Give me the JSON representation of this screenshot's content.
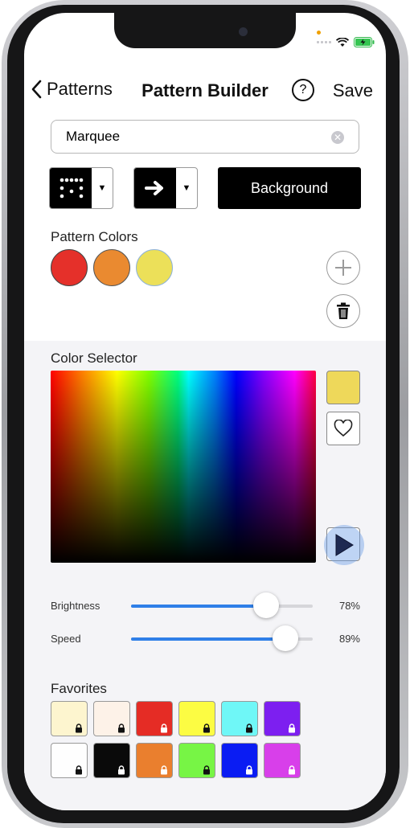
{
  "nav": {
    "back_label": "Patterns",
    "title": "Pattern Builder",
    "help_label": "?",
    "save_label": "Save"
  },
  "name_field": {
    "value": "Marquee"
  },
  "toolbar": {
    "background_label": "Background"
  },
  "pattern_colors": {
    "label": "Pattern Colors",
    "colors": [
      "#e5302a",
      "#ea8a30",
      "#ece059"
    ]
  },
  "color_selector": {
    "label": "Color Selector",
    "selected_color": "#eed85a"
  },
  "sliders": {
    "brightness": {
      "label": "Brightness",
      "value_text": "78%",
      "value": 0.78
    },
    "speed": {
      "label": "Speed",
      "value_text": "89%",
      "value": 0.89
    }
  },
  "favorites": {
    "label": "Favorites",
    "colors": [
      "#fdf5cf",
      "#fdf2e8",
      "#e52c25",
      "#fcfc43",
      "#6ff7f7",
      "#7d1ff0",
      "#fefefe",
      "#0a0a0a",
      "#ea7f2e",
      "#77f545",
      "#0a1cf3",
      "#d83fea"
    ]
  }
}
